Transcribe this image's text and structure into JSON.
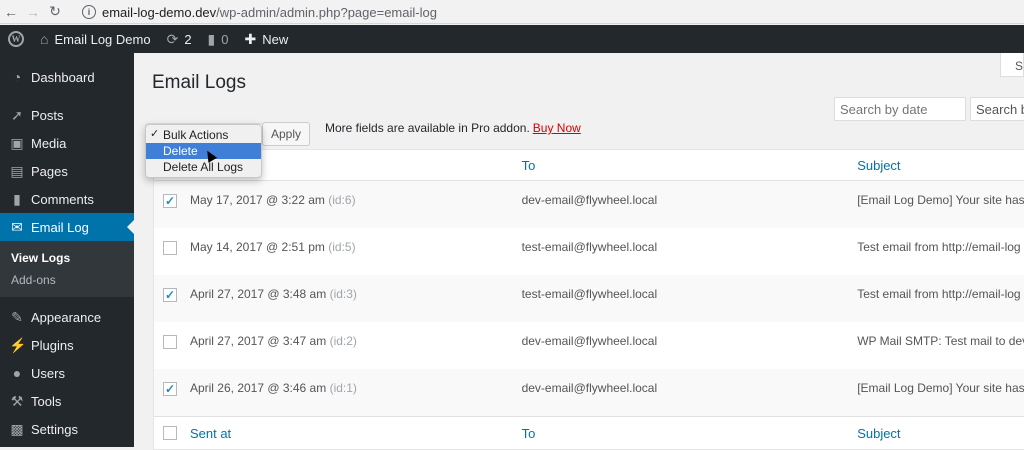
{
  "browser": {
    "url_domain": "email-log-demo.dev",
    "url_path": "/wp-admin/admin.php?page=email-log"
  },
  "adminbar": {
    "site_name": "Email Log Demo",
    "updates_count": "2",
    "comments_count": "0",
    "new_label": "New"
  },
  "sidebar": {
    "items": [
      {
        "label": "Dashboard",
        "icon": "dashboard-icon"
      },
      {
        "label": "Posts",
        "icon": "pin-icon"
      },
      {
        "label": "Media",
        "icon": "media-icon"
      },
      {
        "label": "Pages",
        "icon": "pages-icon"
      },
      {
        "label": "Comments",
        "icon": "comment-icon"
      },
      {
        "label": "Email Log",
        "icon": "email-icon"
      },
      {
        "label": "Appearance",
        "icon": "brush-icon"
      },
      {
        "label": "Plugins",
        "icon": "plugin-icon"
      },
      {
        "label": "Users",
        "icon": "users-icon"
      },
      {
        "label": "Tools",
        "icon": "wrench-icon"
      },
      {
        "label": "Settings",
        "icon": "settings-icon"
      }
    ],
    "submenu": [
      "View Logs",
      "Add-ons"
    ]
  },
  "main": {
    "screen_options": "Sc",
    "title": "Email Logs",
    "search_date_placeholder": "Search by date",
    "search_term_placeholder": "Search b",
    "bulk_options": [
      "Bulk Actions",
      "Delete",
      "Delete All Logs"
    ],
    "bulk_selected": "Bulk Actions",
    "bulk_highlighted": "Delete",
    "apply_label": "Apply",
    "pro_notice": "More fields are available in Pro addon.",
    "buy_now": "Buy Now",
    "columns": {
      "sent_at": "Sent at",
      "to": "To",
      "subject": "Subject"
    },
    "rows": [
      {
        "checked": true,
        "sent": "May 17, 2017 @ 3:22 am",
        "id": "(id:6)",
        "to": "dev-email@flywheel.local",
        "subject": "[Email Log Demo] Your site has"
      },
      {
        "checked": false,
        "sent": "May 14, 2017 @ 2:51 pm",
        "id": "(id:5)",
        "to": "test-email@flywheel.local",
        "subject": "Test email from http://email-log"
      },
      {
        "checked": true,
        "sent": "April 27, 2017 @ 3:48 am",
        "id": "(id:3)",
        "to": "test-email@flywheel.local",
        "subject": "Test email from http://email-log"
      },
      {
        "checked": false,
        "sent": "April 27, 2017 @ 3:47 am",
        "id": "(id:2)",
        "to": "dev-email@flywheel.local",
        "subject": "WP Mail SMTP: Test mail to dev"
      },
      {
        "checked": true,
        "sent": "April 26, 2017 @ 3:46 am",
        "id": "(id:1)",
        "to": "dev-email@flywheel.local",
        "subject": "[Email Log Demo] Your site has"
      }
    ]
  },
  "colors": {
    "accent": "#0073aa",
    "adminbar": "#23282d",
    "buy_now": "#dd0000"
  }
}
